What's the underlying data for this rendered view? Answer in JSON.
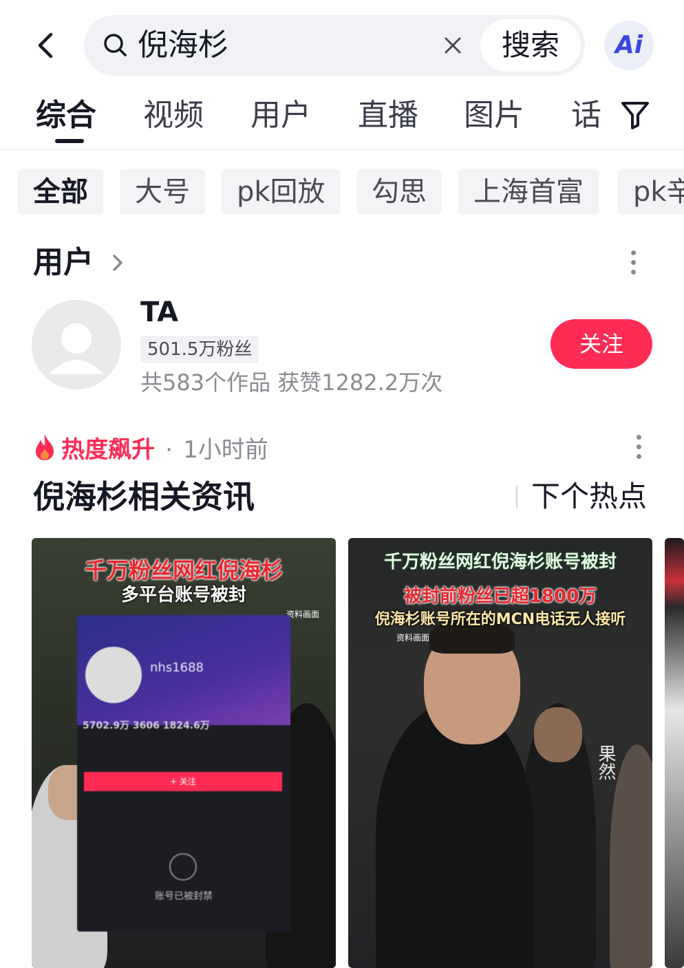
{
  "search": {
    "query": "倪海杉",
    "button_label": "搜索",
    "ai_label": "Ai"
  },
  "tabs": [
    {
      "label": "综合",
      "active": true
    },
    {
      "label": "视频"
    },
    {
      "label": "用户"
    },
    {
      "label": "直播"
    },
    {
      "label": "图片"
    },
    {
      "label": "话"
    }
  ],
  "chips": [
    {
      "label": "全部",
      "active": true
    },
    {
      "label": "大号"
    },
    {
      "label": "pk回放"
    },
    {
      "label": "勾思"
    },
    {
      "label": "上海首富"
    },
    {
      "label": "pk辛"
    }
  ],
  "user_section": {
    "title": "用户",
    "user": {
      "name": "TA",
      "fans": "501.5万粉丝",
      "stats": "共583个作品 获赞1282.2万次",
      "follow_label": "关注"
    }
  },
  "news_section": {
    "hot_tag": "热度飙升",
    "separator": "·",
    "time": "1小时前",
    "title": "倪海杉相关资讯",
    "next_label": "下个热点"
  },
  "videos": [
    {
      "caption_line1": "千万粉丝网红倪海杉",
      "caption_line2": "多平台账号被封",
      "source_note": "资料画面",
      "phone": {
        "handle": "nhs1688",
        "stats": "5702.9万   3606   1824.6万",
        "follow": "+ 关注",
        "banned": "账号已被封禁"
      }
    },
    {
      "caption_line1": "千万粉丝网红倪海杉账号被封",
      "caption_line2": "被封前粉丝已超1800万",
      "caption_line3": "倪海杉账号所在的MCN电话无人接听",
      "source_note": "资料画面",
      "watermark": "果然"
    }
  ],
  "colors": {
    "accent": "#fe2c55",
    "text_primary": "#161823",
    "text_secondary": "#8a8b91",
    "ai_blue": "#3a46e0"
  },
  "icons": [
    "back-arrow-icon",
    "search-icon",
    "clear-icon",
    "filter-icon",
    "chevron-right-icon",
    "more-vertical-icon",
    "flame-icon"
  ]
}
